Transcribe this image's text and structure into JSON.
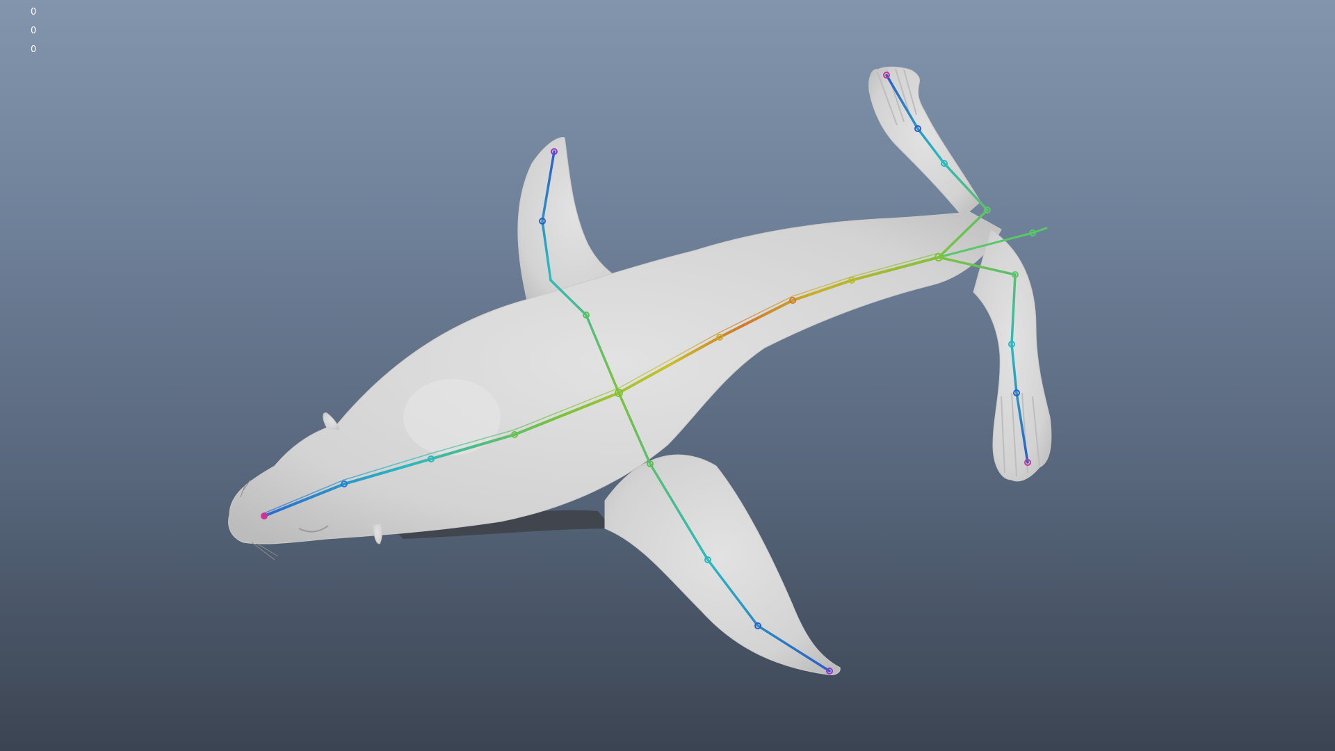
{
  "viewport": {
    "background_top": "#8395ad",
    "background_bottom": "#3b4452"
  },
  "hud": {
    "values": [
      "0",
      "0",
      "0"
    ]
  },
  "model": {
    "icon": "sea-lion-mesh",
    "skin_color": "#d8d8d8"
  },
  "skeleton": {
    "colors": {
      "end_joint": "#cc3399",
      "tip": "#2a5cc8",
      "mid": "#2ab8c8",
      "body": "#7cc33a",
      "spine": "#d08a2a"
    }
  }
}
